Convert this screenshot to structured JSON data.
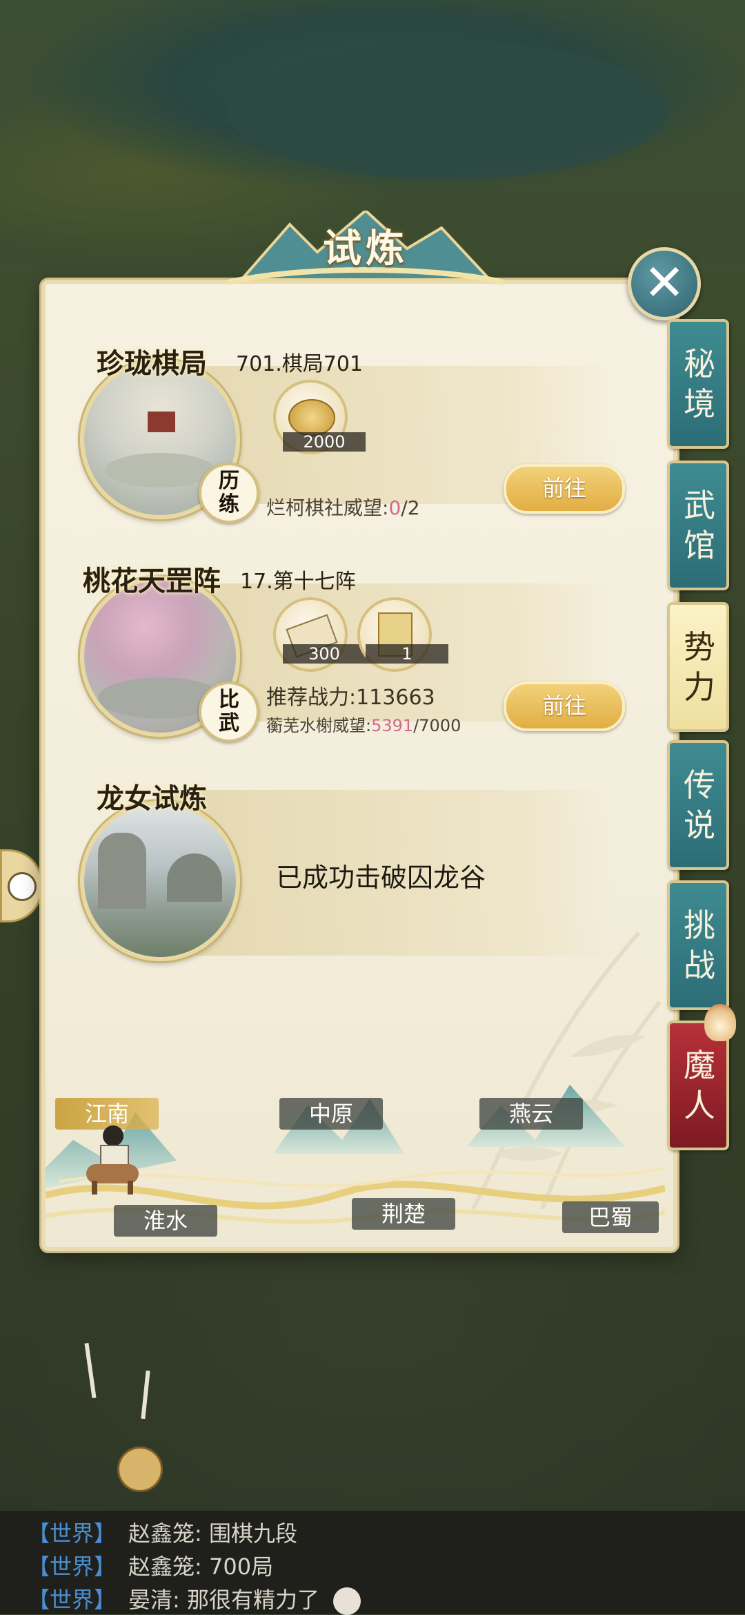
{
  "title": "试炼",
  "close": "✕",
  "tabs": [
    {
      "label": "秘境",
      "active": false
    },
    {
      "label": "武馆",
      "active": false
    },
    {
      "label": "势力",
      "active": true
    },
    {
      "label": "传说",
      "active": false
    },
    {
      "label": "挑战",
      "active": false
    },
    {
      "label": "魔人",
      "active": false
    }
  ],
  "cards": [
    {
      "name": "珍珑棋局",
      "stage": "701.棋局701",
      "badge": "历练",
      "reward_qty": "2000",
      "reputation_label": "烂柯棋社威望:",
      "reputation_current": "0",
      "reputation_max": "/2",
      "button": "前往"
    },
    {
      "name": "桃花天罡阵",
      "stage": "17.第十七阵",
      "badge": "比武",
      "reward1_qty": "300",
      "reward2_qty": "1",
      "power_label": "推荐战力:113663",
      "reputation_label": "蘅芜水榭威望:",
      "reputation_current": "5391",
      "reputation_max": "/7000",
      "button": "前往"
    },
    {
      "name": "龙女试炼",
      "status": "已成功击破囚龙谷"
    }
  ],
  "regions": {
    "jiangnan": "江南",
    "zhongyuan": "中原",
    "yanyun": "燕云",
    "huaishui": "淮水",
    "jingchu": "荆楚",
    "bashu": "巴蜀"
  },
  "chat": [
    {
      "channel": "【世界】",
      "who": "赵鑫笼:",
      "msg": "围棋九段"
    },
    {
      "channel": "【世界】",
      "who": "赵鑫笼:",
      "msg": "700局"
    },
    {
      "channel": "【世界】",
      "who": "晏清:",
      "msg": "那很有精力了"
    }
  ],
  "colors": {
    "tab_teal": "#2c6d76",
    "tab_active": "#efe0a0",
    "tab_demon": "#7d1a22",
    "button_gold": "#e1ae44",
    "reputation_pink": "#d06a8a",
    "chat_channel": "#4a8fd0"
  }
}
